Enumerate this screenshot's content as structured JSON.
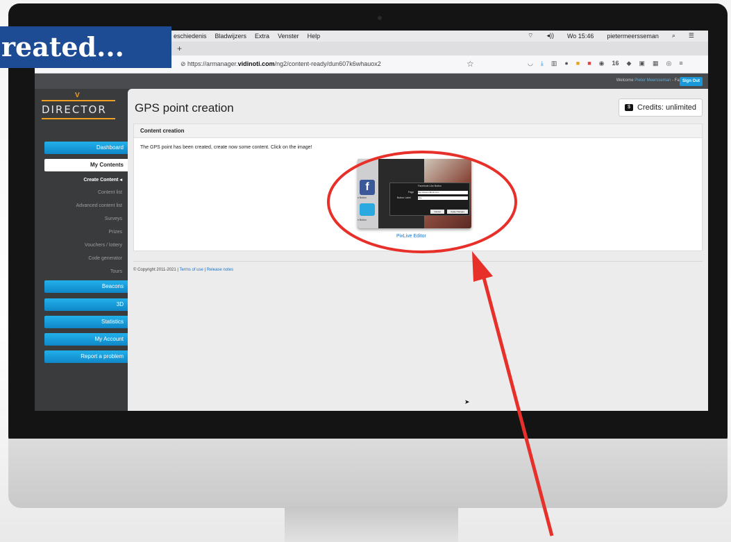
{
  "overlay": {
    "banner_text": "reated...",
    "annotation_color": "#e8302a"
  },
  "os_menubar": {
    "items": [
      "eschiedenis",
      "Bladwijzers",
      "Extra",
      "Venster",
      "Help"
    ],
    "clock": "Wo 15:46",
    "user": "pietermeersseman"
  },
  "browser": {
    "new_tab": "+",
    "url_prefix": "https://armanager.",
    "url_domain": "vidinoti.com",
    "url_path": "/ng2/content-ready/dun607k6whauox2",
    "toolbar_badge": "16"
  },
  "header": {
    "welcome": "Welcome",
    "username": "Pieter Meersseman",
    "org": "- Faro",
    "sign_out": "Sign Out"
  },
  "logo": {
    "text": "DIRECTOR",
    "accent_color": "#f0a020"
  },
  "sidebar": {
    "dashboard": "Dashboard",
    "my_contents": "My Contents",
    "sub_items": [
      "Create Content",
      "Content list",
      "Advanced content list",
      "Surveys",
      "Prizes",
      "Vouchers / lottery",
      "Code generator",
      "Tours"
    ],
    "beacons": "Beacons",
    "three_d": "3D",
    "statistics": "Statistics",
    "my_account": "My Account",
    "report": "Report a problem"
  },
  "main": {
    "title": "GPS point creation",
    "credits": "Credits: unlimited",
    "panel_title": "Content creation",
    "message": "The GPS point has been created, create now some content. Click on the image!",
    "editor_link": "PixLive Editor"
  },
  "thumbnail": {
    "dialog_title": "Facebook Like Button",
    "page_label": "Page",
    "page_value": "http://www.vidinoti.com",
    "button_label": "Button Label",
    "button_value": "Like",
    "cancel": "Cancel",
    "apply": "Apply changes",
    "left_label_1": "e Button",
    "left_label_2": "e Button"
  },
  "footer": {
    "copyright": "© Copyright 2011-2021 |",
    "terms": "Terms of use",
    "sep": "|",
    "release": "Release notes"
  }
}
